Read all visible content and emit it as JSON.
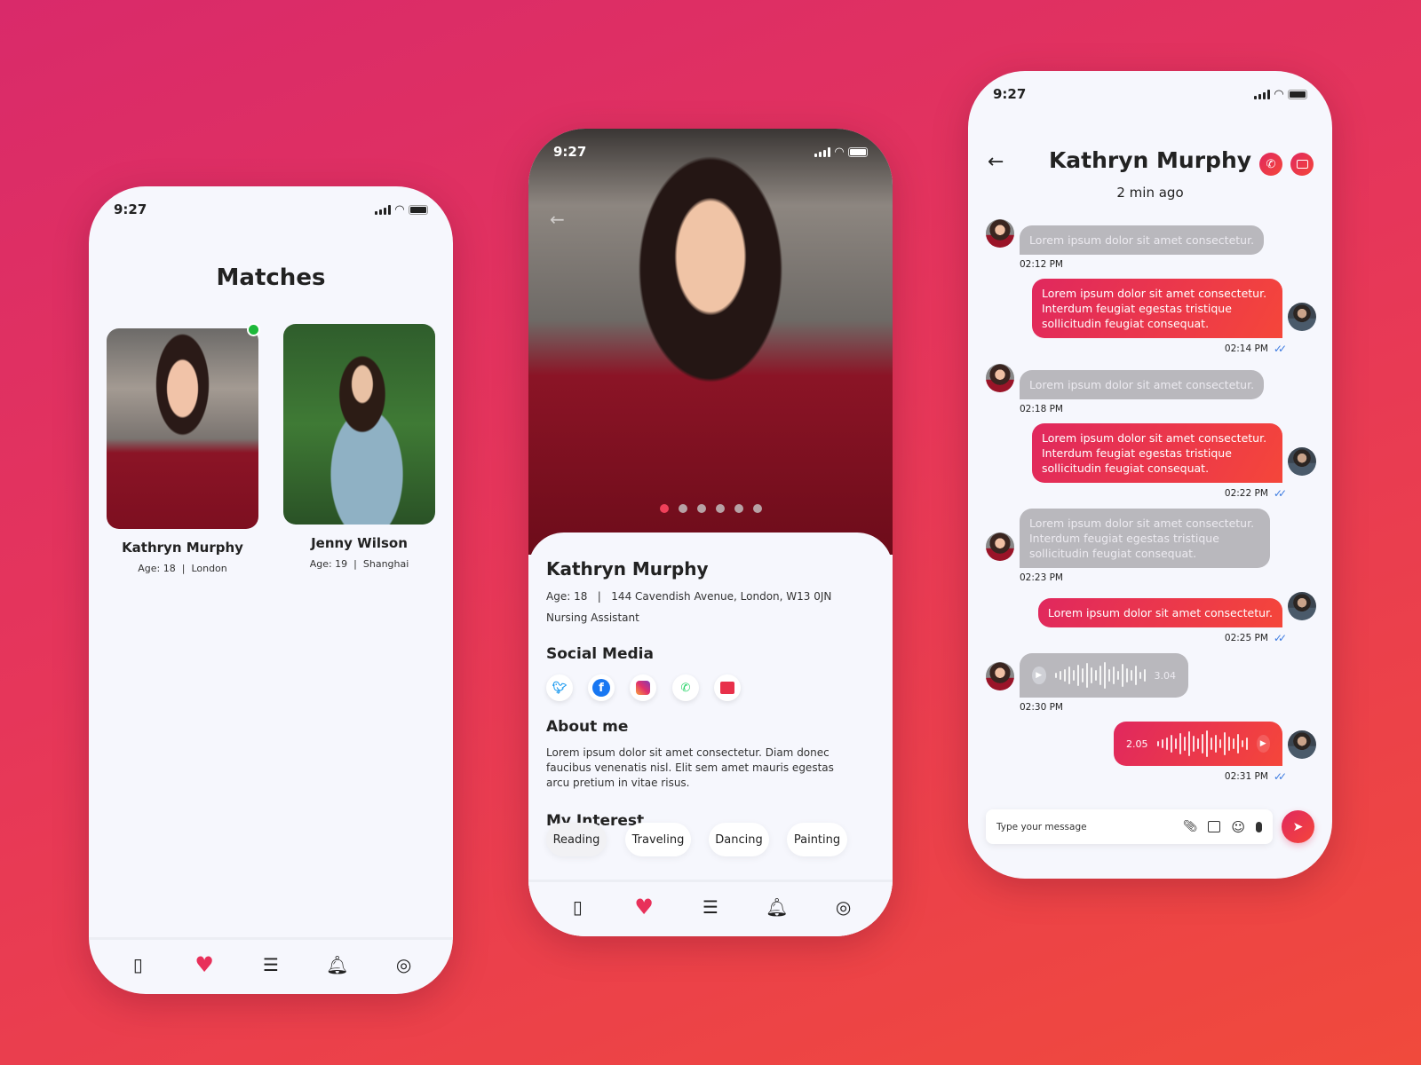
{
  "status_time": "9:27",
  "matches": {
    "title": "Matches",
    "cards": [
      {
        "name": "Kathryn Murphy",
        "age": "Age: 18",
        "sep": "|",
        "city": "London",
        "online": true
      },
      {
        "name": "Jenny Wilson",
        "age": "Age: 19",
        "sep": "|",
        "city": "Shanghai",
        "online": false
      }
    ]
  },
  "profile": {
    "photo_count": 6,
    "active_photo": 1,
    "name": "Kathryn Murphy",
    "age": "Age: 18",
    "sep": "|",
    "address": "144 Cavendish Avenue, London, W13 0JN",
    "job": "Nursing Assistant",
    "social_title": "Social Media",
    "social": [
      "twitter-icon",
      "facebook-icon",
      "instagram-icon",
      "whatsapp-icon",
      "message-icon"
    ],
    "about_title": "About me",
    "about": "Lorem ipsum dolor sit amet consectetur. Diam donec faucibus venenatis nisl. Elit sem amet mauris egestas arcu pretium in vitae risus.",
    "interest_title": "My Interest",
    "interests": [
      "Reading",
      "Traveling",
      "Dancing",
      "Painting"
    ]
  },
  "nav": [
    "cards-icon",
    "heart-icon",
    "chat-icon",
    "bell-icon",
    "profile-icon"
  ],
  "nav_active": 1,
  "chat": {
    "name": "Kathryn Murphy",
    "last_seen": "2 min ago",
    "messages": [
      {
        "dir": "in",
        "text": "Lorem ipsum dolor sit amet consectetur.",
        "time": "02:12 PM"
      },
      {
        "dir": "out",
        "text": "Lorem ipsum dolor sit amet consectetur. Interdum feugiat egestas tristique sollicitudin feugiat consequat.",
        "time": "02:14 PM",
        "read": true
      },
      {
        "dir": "in",
        "text": "Lorem ipsum dolor sit amet consectetur.",
        "time": "02:18 PM"
      },
      {
        "dir": "out",
        "text": "Lorem ipsum dolor sit amet consectetur. Interdum feugiat egestas tristique sollicitudin feugiat consequat.",
        "time": "02:22 PM",
        "read": true
      },
      {
        "dir": "in",
        "text": "Lorem ipsum dolor sit amet consectetur. Interdum feugiat egestas tristique sollicitudin feugiat consequat.",
        "time": "02:23 PM"
      },
      {
        "dir": "out",
        "text": "Lorem ipsum dolor sit amet consectetur.",
        "time": "02:25 PM",
        "read": true
      },
      {
        "dir": "in",
        "voice": "3.04",
        "time": "02:30 PM"
      },
      {
        "dir": "out",
        "voice": "2.05",
        "time": "02:31 PM",
        "read": true
      }
    ],
    "input_placeholder": "Type your message"
  },
  "colors": {
    "accent": "#e8305a",
    "online": "#1db83a",
    "read": "#3d7be0"
  }
}
